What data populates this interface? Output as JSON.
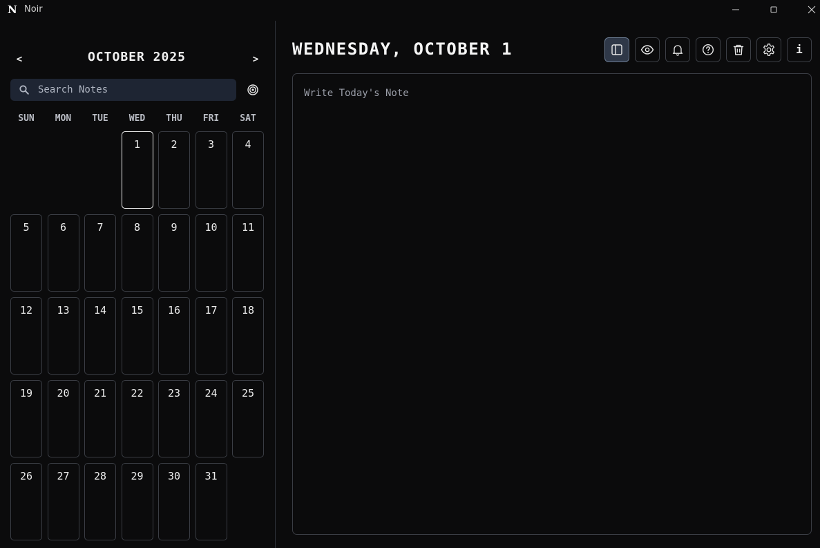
{
  "window": {
    "app_logo": "N",
    "app_title": "Noir"
  },
  "calendar": {
    "prev_label": "<",
    "next_label": ">",
    "month_title": "OCTOBER 2025",
    "weekdays": [
      "SUN",
      "MON",
      "TUE",
      "WED",
      "THU",
      "FRI",
      "SAT"
    ],
    "first_weekday_index": 3,
    "days_in_month": 31,
    "selected_day": 1,
    "days": [
      "1",
      "2",
      "3",
      "4",
      "5",
      "6",
      "7",
      "8",
      "9",
      "10",
      "11",
      "12",
      "13",
      "14",
      "15",
      "16",
      "17",
      "18",
      "19",
      "20",
      "21",
      "22",
      "23",
      "24",
      "25",
      "26",
      "27",
      "28",
      "29",
      "30",
      "31"
    ]
  },
  "search": {
    "placeholder": "Search Notes",
    "value": ""
  },
  "main": {
    "date_heading": "WEDNESDAY, OCTOBER 1",
    "editor_placeholder": "Write Today's Note",
    "editor_value": ""
  },
  "toolbar": {
    "buttons": [
      {
        "icon": "sidebar-toggle-icon",
        "active": true
      },
      {
        "icon": "eye-icon",
        "active": false
      },
      {
        "icon": "bell-icon",
        "active": false
      },
      {
        "icon": "help-circle-icon",
        "active": false
      },
      {
        "icon": "trash-icon",
        "active": false
      },
      {
        "icon": "gear-icon",
        "active": false
      },
      {
        "icon": "info-icon",
        "active": false,
        "glyph": "i"
      }
    ]
  },
  "colors": {
    "background": "#0b0b0c",
    "search_bg": "#1e2533",
    "active_button_bg": "#2f3848",
    "border": "#3a3d44",
    "text": "#e6e6e6"
  }
}
